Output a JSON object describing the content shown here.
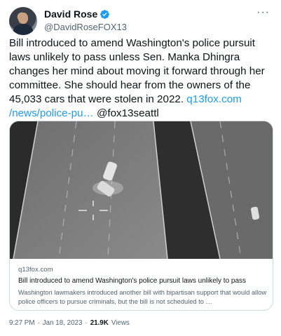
{
  "author": {
    "name": "David Rose",
    "handle": "@DavidRoseFOX13"
  },
  "menu": {
    "more_label": "···"
  },
  "tweet": {
    "text_main": "Bill introduced to amend Washington's police pursuit laws unlikely to pass unless Sen. Manka Dhingra changes her mind about moving it forward through her committee.  She should hear from the owners of the 45,033 cars that were stolen in 2022. ",
    "link_text": "q13fox.com /news/police-pu…",
    "mention": " @fox13seattl"
  },
  "card": {
    "domain": "q13fox.com",
    "title": "Bill introduced to amend Washington's police pursuit laws unlikely to pass",
    "description": "Washington lawmakers introduced another bill with bipartisan support that would allow police officers to pursue criminals, but the bill is not scheduled to …"
  },
  "meta": {
    "time": "9:27 PM",
    "separator": "·",
    "date": "Jan 18, 2023",
    "views_count": "21.9K",
    "views_label": "Views"
  },
  "colors": {
    "link": "#1d9bf0",
    "verified": "#1d9bf0",
    "secondary_text": "#536471"
  }
}
